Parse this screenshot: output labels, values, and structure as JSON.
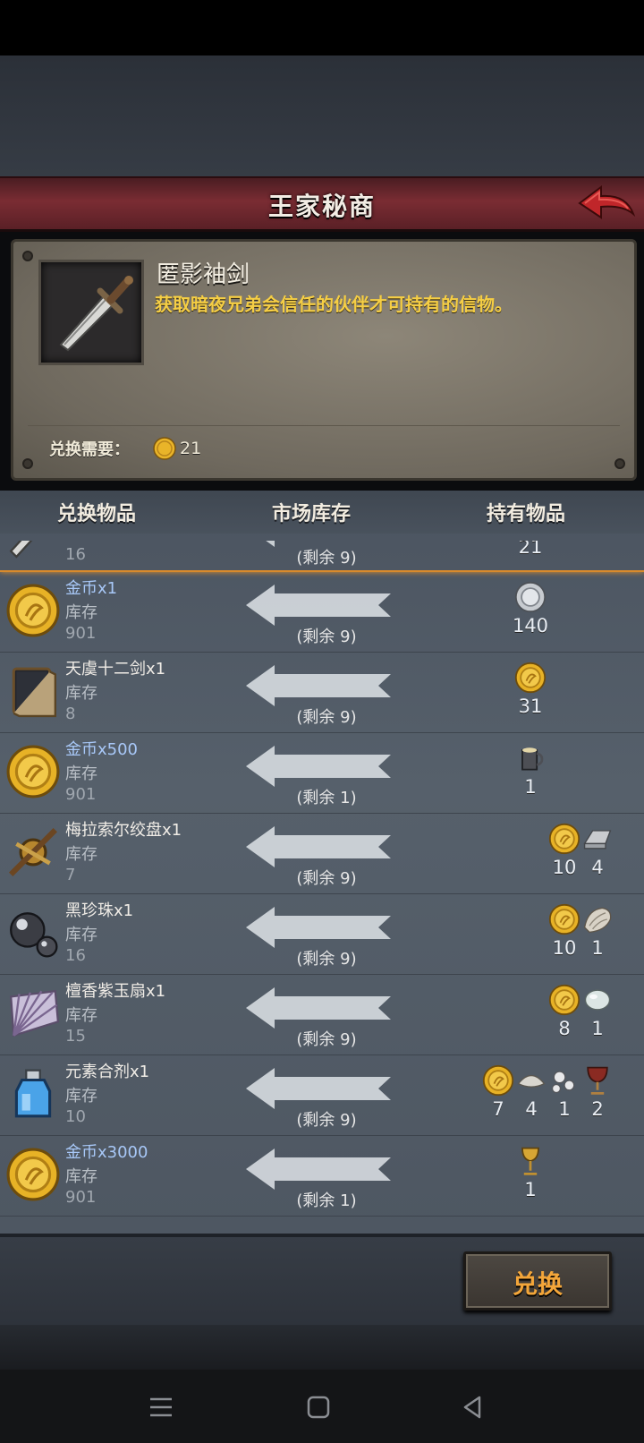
{
  "header": {
    "title": "王家秘商"
  },
  "item_detail": {
    "name": "匿影袖剑",
    "description": "获取暗夜兄弟会信任的伙伴才可持有的信物。",
    "cost_label": "兑换需要：",
    "cost_value": "21"
  },
  "columns": {
    "exchange_item": "兑换物品",
    "market_stock": "市场库存",
    "held_items": "持有物品"
  },
  "rows": [
    {
      "icon": "dagger-icon",
      "name": "",
      "currency": false,
      "stock_label": "库存",
      "stock": "16",
      "remain": "(剩余 9)",
      "selected": true,
      "held": [
        {
          "icon": "gold-coin-icon",
          "value": "21"
        }
      ]
    },
    {
      "icon": "gold-coin-icon",
      "name": "金币x1",
      "currency": true,
      "stock_label": "库存",
      "stock": "901",
      "remain": "(剩余 9)",
      "held": [
        {
          "icon": "silver-coin-icon",
          "value": "140"
        }
      ]
    },
    {
      "icon": "book-icon",
      "name": "天虞十二剑x1",
      "currency": false,
      "stock_label": "库存",
      "stock": "8",
      "remain": "(剩余 9)",
      "held": [
        {
          "icon": "gold-coin-icon",
          "value": "31"
        }
      ]
    },
    {
      "icon": "gold-coin-icon",
      "name": "金币x500",
      "currency": true,
      "stock_label": "库存",
      "stock": "901",
      "remain": "(剩余 1)",
      "held": [
        {
          "icon": "tankard-icon",
          "value": "1"
        }
      ]
    },
    {
      "icon": "astrolabe-icon",
      "name": "梅拉索尔绞盘x1",
      "currency": false,
      "stock_label": "库存",
      "stock": "7",
      "remain": "(剩余 9)",
      "held": [
        {
          "icon": "gold-coin-icon",
          "value": "10"
        },
        {
          "icon": "ingot-icon",
          "value": "4"
        }
      ]
    },
    {
      "icon": "black-pearl-icon",
      "name": "黑珍珠x1",
      "currency": false,
      "stock_label": "库存",
      "stock": "16",
      "remain": "(剩余 9)",
      "held": [
        {
          "icon": "gold-coin-icon",
          "value": "10"
        },
        {
          "icon": "fur-icon",
          "value": "1"
        }
      ]
    },
    {
      "icon": "fan-icon",
      "name": "檀香紫玉扇x1",
      "currency": false,
      "stock_label": "库存",
      "stock": "15",
      "remain": "(剩余 9)",
      "held": [
        {
          "icon": "gold-coin-icon",
          "value": "8"
        },
        {
          "icon": "jade-icon",
          "value": "1"
        }
      ]
    },
    {
      "icon": "potion-icon",
      "name": "元素合剂x1",
      "currency": false,
      "stock_label": "库存",
      "stock": "10",
      "remain": "(剩余 9)",
      "held": [
        {
          "icon": "gold-coin-icon",
          "value": "7"
        },
        {
          "icon": "shell-icon",
          "value": "4"
        },
        {
          "icon": "pearls-icon",
          "value": "1"
        },
        {
          "icon": "goblet-icon",
          "value": "2"
        }
      ]
    },
    {
      "icon": "gold-coin-icon",
      "name": "金币x3000",
      "currency": true,
      "stock_label": "库存",
      "stock": "901",
      "remain": "(剩余 1)",
      "held": [
        {
          "icon": "golden-chalice-icon",
          "value": "1"
        }
      ]
    }
  ],
  "actions": {
    "exchange_label": "兑换"
  },
  "colors": {
    "title_bar": "#7a2c33",
    "description": "#f5ce45",
    "currency_name": "#a8c8f8",
    "selection": "#d88a2c",
    "button_text": "#f3a63a"
  }
}
